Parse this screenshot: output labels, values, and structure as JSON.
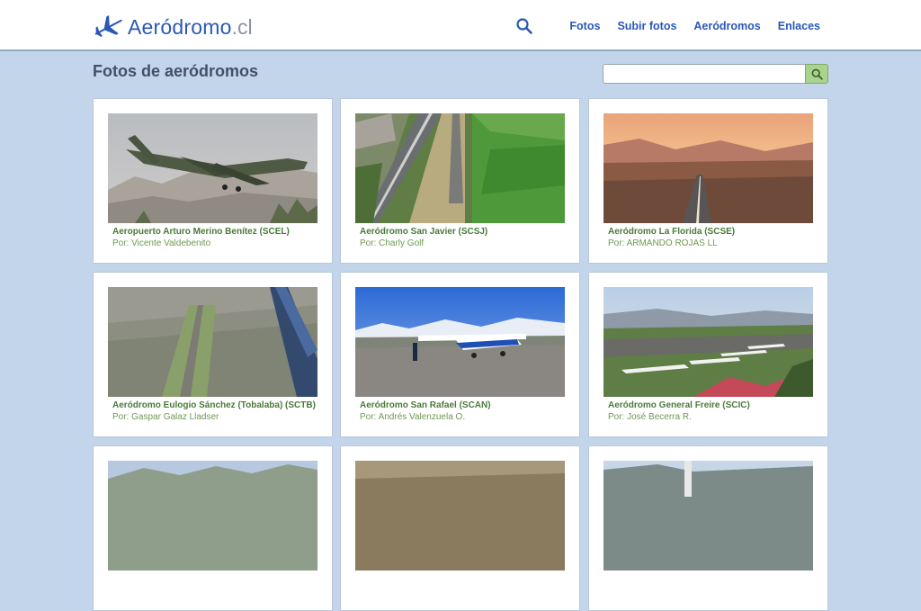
{
  "header": {
    "logo_text": "Aeródromo",
    "logo_tld": ".cl",
    "nav": [
      "Fotos",
      "Subir fotos",
      "Aeródromos",
      "Enlaces"
    ]
  },
  "main": {
    "title": "Fotos de aeródromos",
    "search": {
      "placeholder": "",
      "value": ""
    },
    "cards": [
      {
        "title": "Aeropuerto Arturo Merino Benítez (SCEL)",
        "author": "Por: Vicente Valdebenito"
      },
      {
        "title": "Aeródromo San Javier (SCSJ)",
        "author": "Por: Charly Golf"
      },
      {
        "title": "Aeródromo La Florida (SCSE)",
        "author": "Por: ARMANDO ROJAS LL"
      },
      {
        "title": "Aeródromo Eulogio Sánchez (Tobalaba) (SCTB)",
        "author": "Por: Gaspar Galaz Lladser"
      },
      {
        "title": "Aeródromo San Rafael (SCAN)",
        "author": "Por: Andrés Valenzuela O."
      },
      {
        "title": "Aeródromo General Freire (SCIC)",
        "author": "Por: José Becerra R."
      }
    ]
  },
  "icons": {
    "logo": "plane-icon",
    "search": "search-icon"
  },
  "colors": {
    "brand": "#2a57b8",
    "background": "#c3d5ea",
    "caption_title": "#4a7a3a",
    "caption_author": "#6e9a52",
    "search_button": "#a9d48e"
  }
}
